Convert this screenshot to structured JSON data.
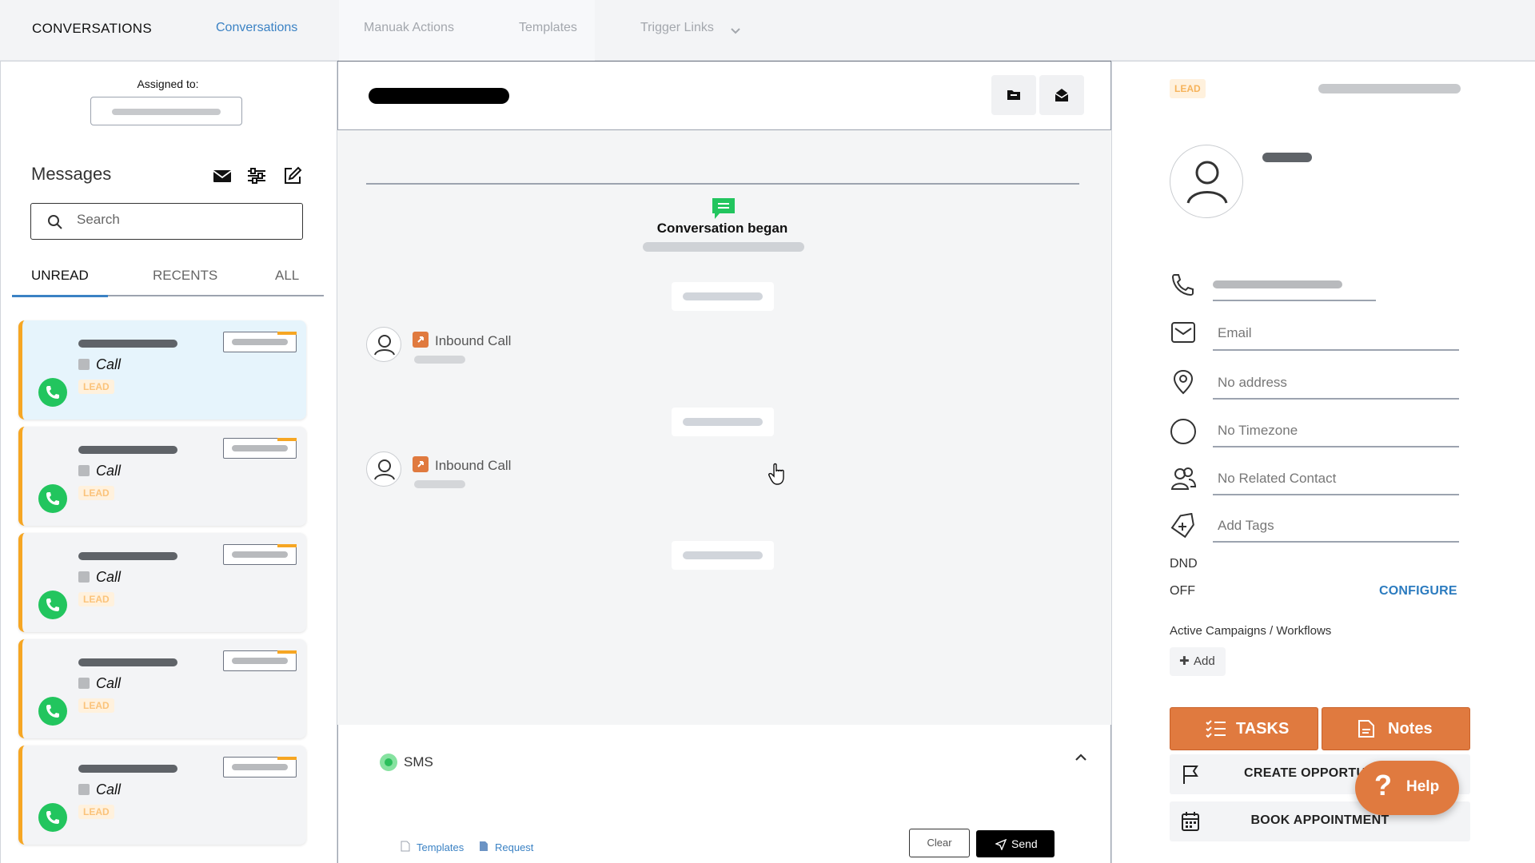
{
  "topnav": {
    "brand": "CONVERSATIONS",
    "tabs": [
      {
        "label": "Conversations",
        "active": true
      },
      {
        "label": "Manuak Actions",
        "active": false
      },
      {
        "label": "Templates",
        "active": false
      },
      {
        "label": "Trigger Links",
        "active": false
      }
    ]
  },
  "left": {
    "assigned_label": "Assigned to:",
    "messages_title": "Messages",
    "search_placeholder": "Search",
    "tabs": [
      "UNREAD",
      "RECENTS",
      "ALL"
    ],
    "active_tab": "UNREAD",
    "cards": [
      {
        "type": "Call",
        "badge": "LEAD",
        "selected": true
      },
      {
        "type": "Call",
        "badge": "LEAD",
        "selected": false
      },
      {
        "type": "Call",
        "badge": "LEAD",
        "selected": false
      },
      {
        "type": "Call",
        "badge": "LEAD",
        "selected": false
      },
      {
        "type": "Call",
        "badge": "LEAD",
        "selected": false
      }
    ]
  },
  "center": {
    "began_label": "Conversation began",
    "events": [
      {
        "label": "Inbound Call"
      },
      {
        "label": "Inbound Call"
      }
    ],
    "composer": {
      "channel": "SMS",
      "templates_link": "Templates",
      "request_link": "Request",
      "clear_label": "Clear",
      "send_label": "Send"
    }
  },
  "right": {
    "lead_badge": "LEAD",
    "email_placeholder": "Email",
    "address": "No address",
    "timezone": "No Timezone",
    "related": "No Related Contact",
    "tags": "Add Tags",
    "dnd_label": "DND",
    "dnd_value": "OFF",
    "configure": "CONFIGURE",
    "campaigns_label": "Active Campaigns / Workflows",
    "add_label": "Add",
    "tasks_label": "TASKS",
    "notes_label": "Notes",
    "create_opp_label": "CREATE OPPORTUNITY",
    "book_label": "BOOK APPOINTMENT",
    "help_label": "Help"
  },
  "colors": {
    "accent_blue": "#3b82c4",
    "orange": "#e07a3f",
    "card_border": "#f6a623",
    "green": "#22c55e"
  }
}
